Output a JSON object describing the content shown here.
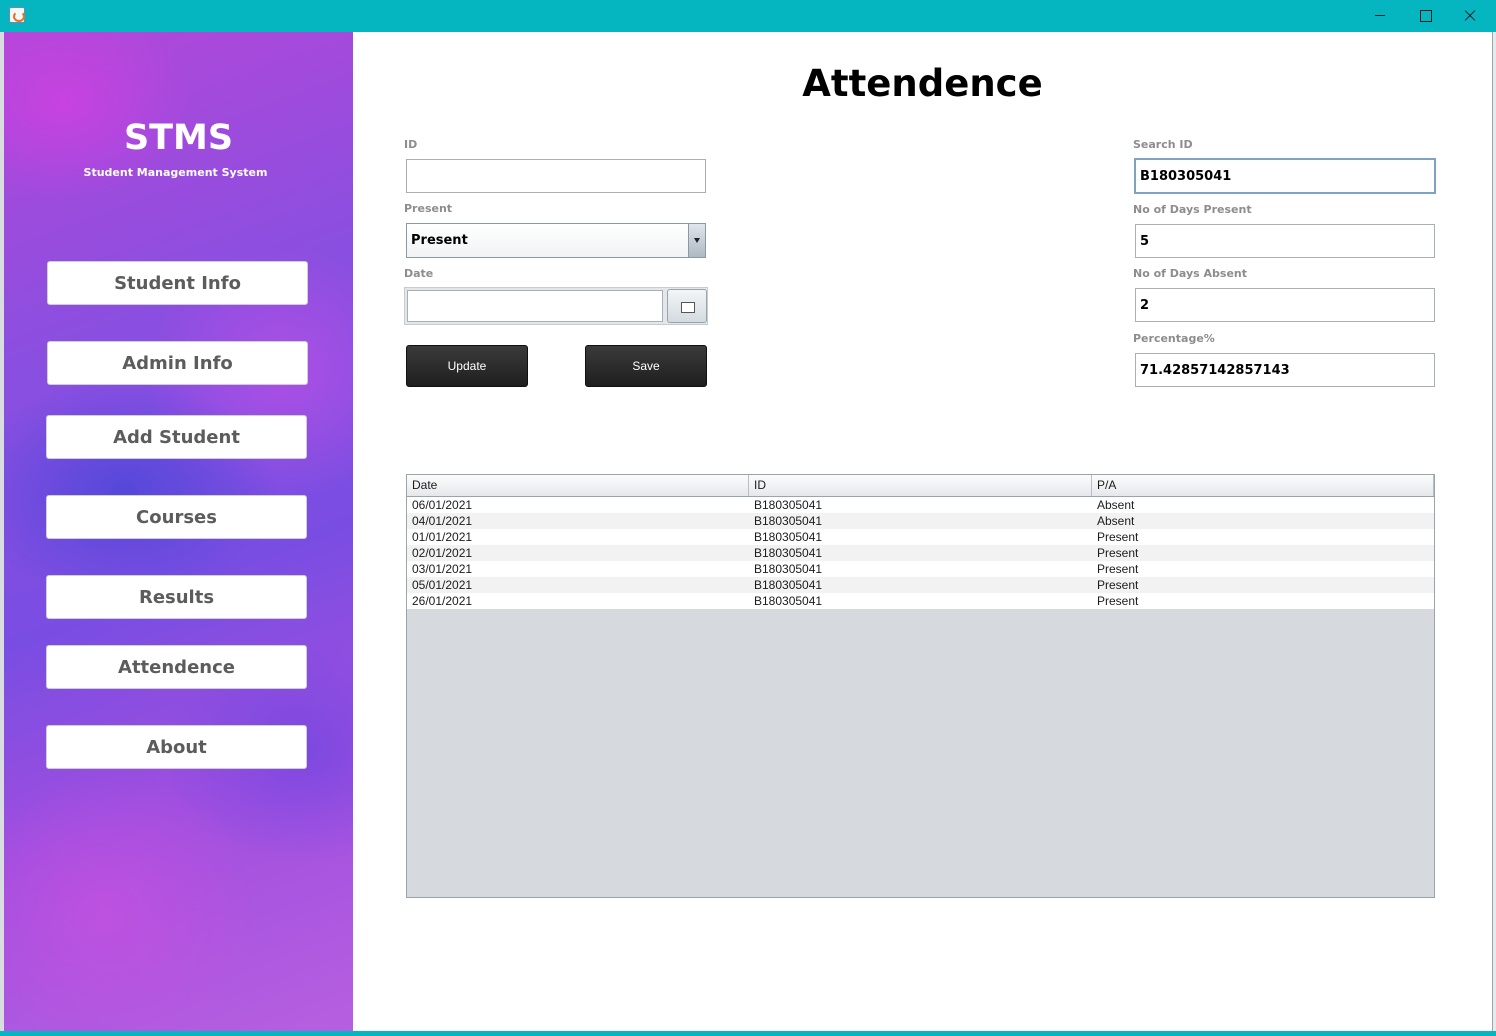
{
  "window": {
    "icon": "java-cup-icon"
  },
  "sidebar": {
    "brand": "STMS",
    "subtitle": "Student Management System",
    "items": [
      {
        "label": "Student Info"
      },
      {
        "label": "Admin Info"
      },
      {
        "label": "Add Student"
      },
      {
        "label": "Courses"
      },
      {
        "label": "Results"
      },
      {
        "label": "Attendence"
      },
      {
        "label": "About"
      }
    ]
  },
  "main": {
    "title": "Attendence",
    "form": {
      "id_label": "ID",
      "id_value": "",
      "present_label": "Present",
      "present_selected": "Present",
      "date_label": "Date",
      "date_value": "",
      "update_label": "Update",
      "save_label": "Save"
    },
    "search": {
      "search_label": "Search ID",
      "search_value": "B180305041",
      "days_present_label": "No of Days Present",
      "days_present_value": "5",
      "days_absent_label": "No of Days Absent",
      "days_absent_value": "2",
      "percentage_label": "Percentage%",
      "percentage_value": "71.42857142857143"
    },
    "table": {
      "columns": [
        "Date",
        "ID",
        "P/A"
      ],
      "rows": [
        [
          "06/01/2021",
          "B180305041",
          "Absent"
        ],
        [
          "04/01/2021",
          "B180305041",
          "Absent"
        ],
        [
          "01/01/2021",
          "B180305041",
          "Present"
        ],
        [
          "02/01/2021",
          "B180305041",
          "Present"
        ],
        [
          "03/01/2021",
          "B180305041",
          "Present"
        ],
        [
          "05/01/2021",
          "B180305041",
          "Present"
        ],
        [
          "26/01/2021",
          "B180305041",
          "Present"
        ]
      ]
    }
  }
}
